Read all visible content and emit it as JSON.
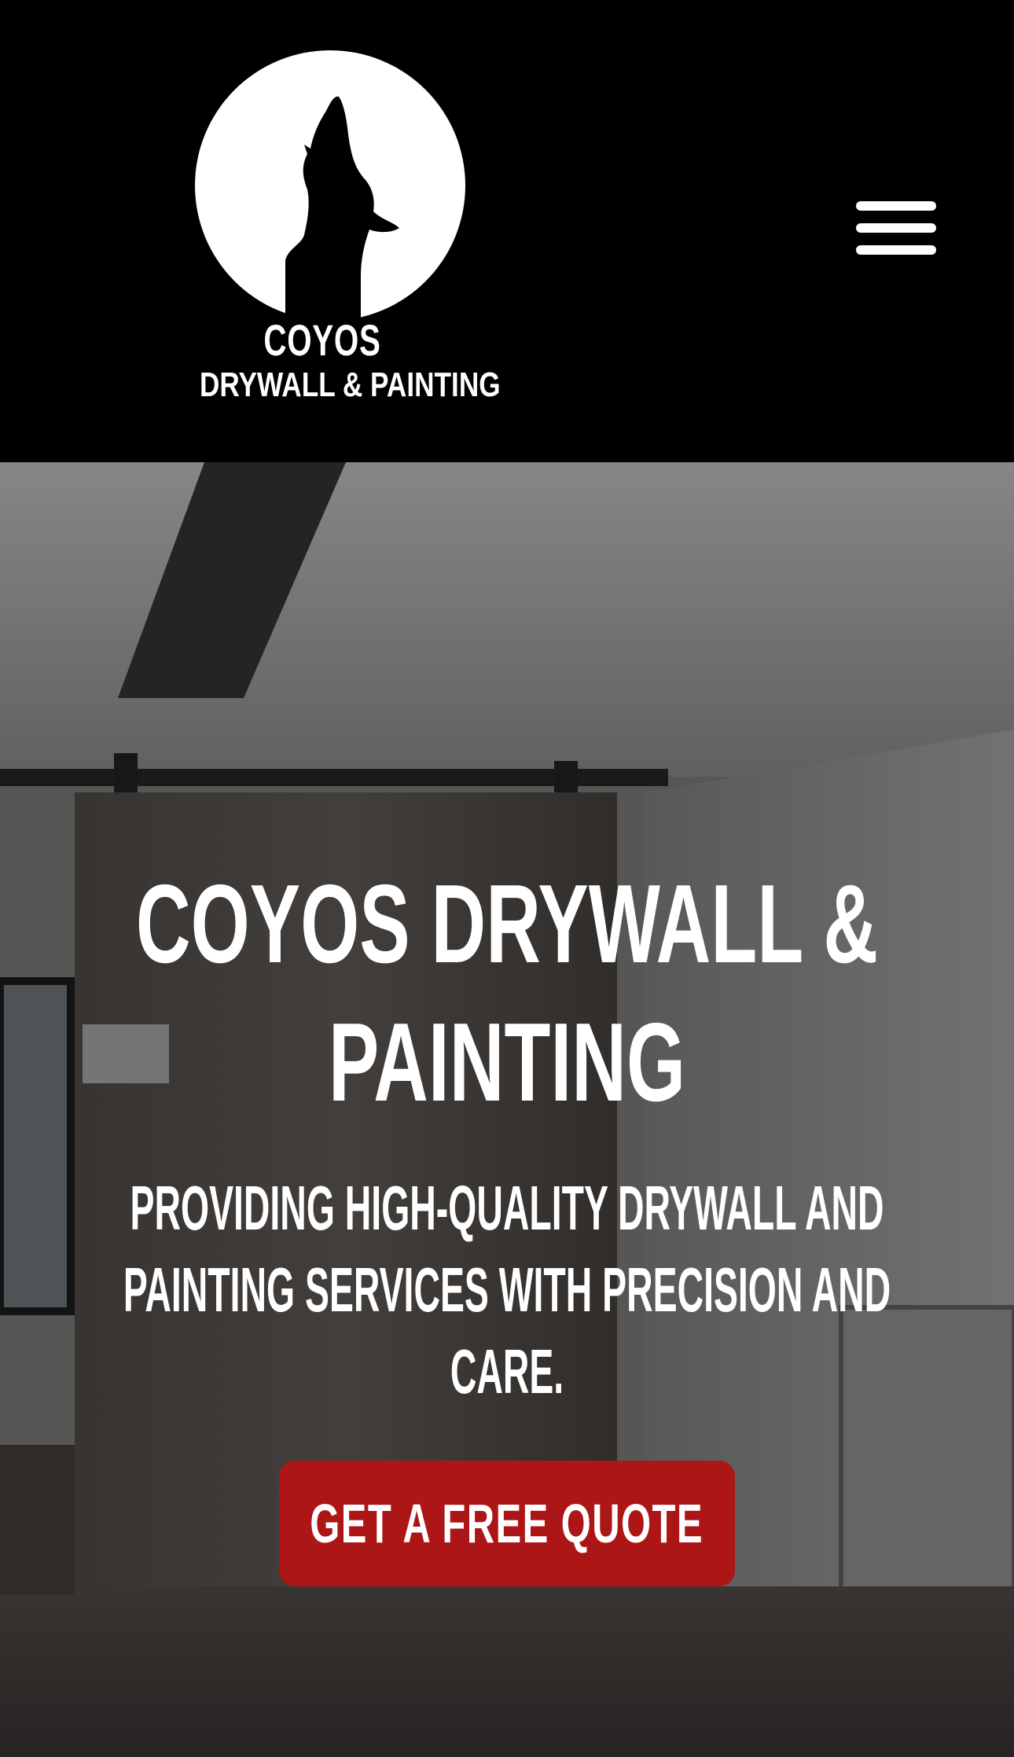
{
  "header": {
    "logo": {
      "icon": "howling-coyote-moon-icon",
      "name": "COYOS",
      "tagline": "DRYWALL & PAINTING"
    },
    "menu_icon": "hamburger-menu-icon"
  },
  "hero": {
    "title": "COYOS DRYWALL & PAINTING",
    "subtitle": "PROVIDING HIGH-QUALITY DRYWALL AND PAINTING SERVICES WITH PRECISION AND CARE.",
    "cta_label": "GET A FREE QUOTE",
    "background": "interior-room-photo"
  },
  "colors": {
    "header_bg": "#000000",
    "text": "#ffffff",
    "cta_bg": "#ad1616"
  }
}
